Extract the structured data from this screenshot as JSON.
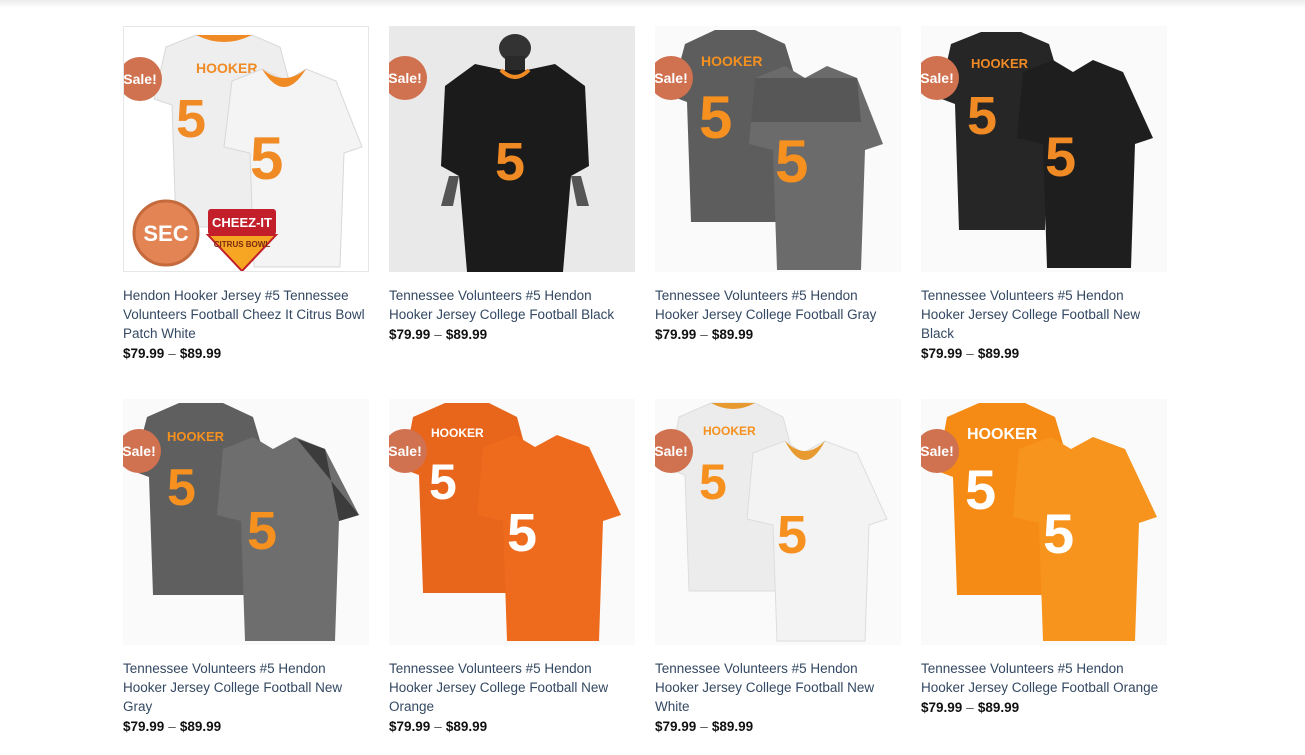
{
  "products": [
    {
      "title": "Hendon Hooker Jersey #5 Tennessee Volunteers Football Cheez It Citrus Bowl Patch White",
      "price_min": "$79.99",
      "price_sep": "–",
      "price_max": "$89.99",
      "badge": "Sale!",
      "name": "HOOKER",
      "number": "5",
      "patch_sec": "SEC",
      "patch_cheez": "CHEEZ-IT",
      "patch_bowl": "CITRUS BOWL",
      "colors": {
        "front": "#f4f4f4",
        "back": "#eeeeee",
        "numeral": "#f08a24",
        "trim": "#f08a24"
      }
    },
    {
      "title": "Tennessee Volunteers #5 Hendon Hooker Jersey College Football Black",
      "price_min": "$79.99",
      "price_sep": "–",
      "price_max": "$89.99",
      "badge": "Sale!",
      "number": "5",
      "colors": {
        "front": "#1b1b1b",
        "numeral": "#f08a24",
        "trim": "#f08a24"
      }
    },
    {
      "title": "Tennessee Volunteers #5 Hendon Hooker Jersey College Football Gray",
      "price_min": "$79.99",
      "price_sep": "–",
      "price_max": "$89.99",
      "badge": "Sale!",
      "name": "HOOKER",
      "number": "5",
      "colors": {
        "front": "#6b6b6b",
        "back": "#5d5d5d",
        "numeral": "#f6901e",
        "trim": "#4a4a4a"
      }
    },
    {
      "title": "Tennessee Volunteers #5 Hendon Hooker Jersey College Football New Black",
      "price_min": "$79.99",
      "price_sep": "–",
      "price_max": "$89.99",
      "badge": "Sale!",
      "name": "HOOKER",
      "number": "5",
      "colors": {
        "front": "#1e1e1e",
        "back": "#262626",
        "numeral": "#f08a24",
        "trim": "#111111"
      }
    },
    {
      "title": "Tennessee Volunteers #5 Hendon Hooker Jersey College Football New Gray",
      "price_min": "$79.99",
      "price_sep": "–",
      "price_max": "$89.99",
      "badge": "Sale!",
      "name": "HOOKER",
      "number": "5",
      "colors": {
        "front": "#6e6e6e",
        "back": "#5f5f5f",
        "numeral": "#f6901e",
        "trim": "#3c3c3c"
      }
    },
    {
      "title": "Tennessee Volunteers #5 Hendon Hooker Jersey College Football New Orange",
      "price_min": "$79.99",
      "price_sep": "–",
      "price_max": "$89.99",
      "badge": "Sale!",
      "name": "HOOKER",
      "number": "5",
      "colors": {
        "front": "#ee6a1c",
        "back": "#e8651c",
        "numeral": "#ffffff",
        "trim": "#ee6a1c"
      }
    },
    {
      "title": "Tennessee Volunteers #5 Hendon Hooker Jersey College Football New White",
      "price_min": "$79.99",
      "price_sep": "–",
      "price_max": "$89.99",
      "badge": "Sale!",
      "name": "HOOKER",
      "number": "5",
      "colors": {
        "front": "#f3f3f3",
        "back": "#ececec",
        "numeral": "#f6901e",
        "trim": "#e79a30"
      }
    },
    {
      "title": "Tennessee Volunteers #5 Hendon Hooker Jersey College Football Orange",
      "price_min": "$79.99",
      "price_sep": "–",
      "price_max": "$89.99",
      "badge": "Sale!",
      "name": "HOOKER",
      "number": "5",
      "colors": {
        "front": "#f7941e",
        "back": "#f58b14",
        "numeral": "#ffffff",
        "trim": "#f7941e"
      }
    }
  ]
}
